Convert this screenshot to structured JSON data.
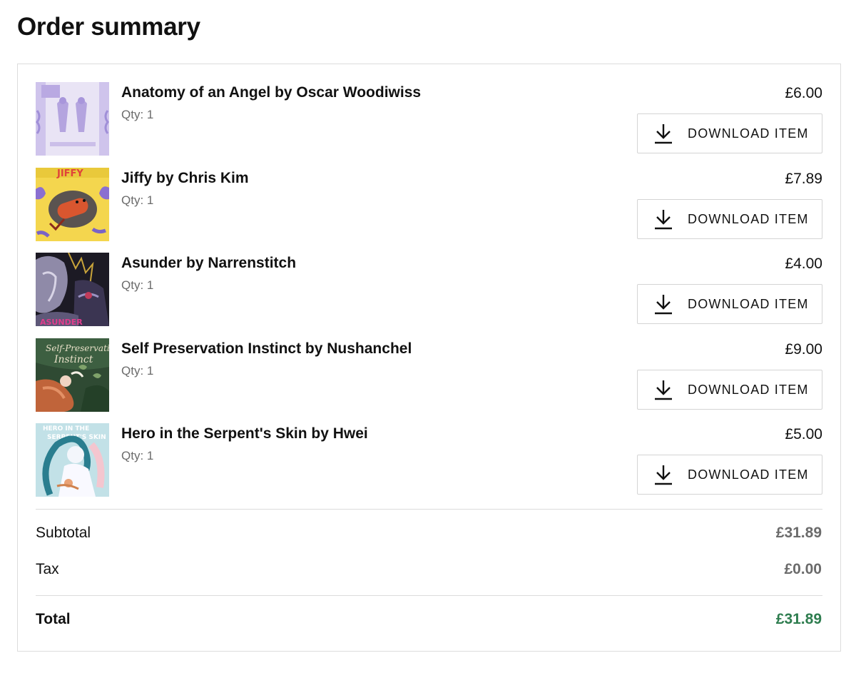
{
  "page": {
    "title": "Order summary"
  },
  "items": [
    {
      "title": "Anatomy of an Angel by Oscar Woodiwiss",
      "qty": "Qty: 1",
      "price": "£6.00",
      "download_label": "DOWNLOAD ITEM",
      "cover": "anatomy-of-an-angel-cover"
    },
    {
      "title": "Jiffy by Chris Kim",
      "qty": "Qty: 1",
      "price": "£7.89",
      "download_label": "DOWNLOAD ITEM",
      "cover": "jiffy-cover"
    },
    {
      "title": "Asunder by Narrenstitch",
      "qty": "Qty: 1",
      "price": "£4.00",
      "download_label": "DOWNLOAD ITEM",
      "cover": "asunder-cover"
    },
    {
      "title": "Self Preservation Instinct by Nushanchel",
      "qty": "Qty: 1",
      "price": "£9.00",
      "download_label": "DOWNLOAD ITEM",
      "cover": "self-preservation-instinct-cover"
    },
    {
      "title": "Hero in the Serpent's Skin by Hwei",
      "qty": "Qty: 1",
      "price": "£5.00",
      "download_label": "DOWNLOAD ITEM",
      "cover": "hero-in-the-serpents-skin-cover"
    }
  ],
  "totals": {
    "subtotal_label": "Subtotal",
    "subtotal_value": "£31.89",
    "tax_label": "Tax",
    "tax_value": "£0.00",
    "total_label": "Total",
    "total_value": "£31.89"
  },
  "colors": {
    "total_accent": "#2e7d4f",
    "muted_text": "#6b6b6b",
    "border": "#dcdcdc"
  },
  "icons": {
    "download": "download-icon"
  }
}
